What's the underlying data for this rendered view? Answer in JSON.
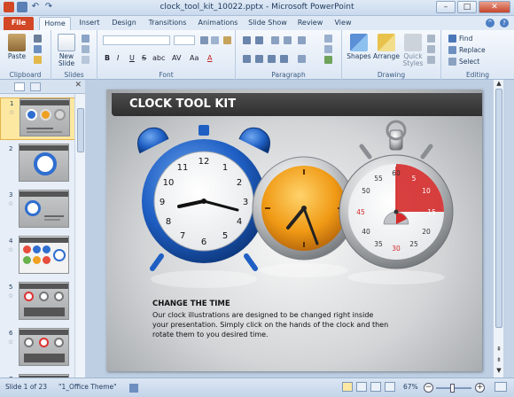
{
  "window": {
    "title": "clock_tool_kit_10022.pptx - Microsoft PowerPoint"
  },
  "tabs": [
    "File",
    "Home",
    "Insert",
    "Design",
    "Transitions",
    "Animations",
    "Slide Show",
    "Review",
    "View"
  ],
  "ribbon": {
    "clipboard": {
      "paste": "Paste",
      "label": "Clipboard"
    },
    "slides": {
      "new_slide_1": "New",
      "new_slide_2": "Slide",
      "label": "Slides"
    },
    "font": {
      "label": "Font",
      "bold": "B",
      "italic": "I",
      "underline": "U",
      "strike": "S",
      "shadow": "abc",
      "spacing": "AV",
      "case": "Aa",
      "color": "A"
    },
    "paragraph": {
      "label": "Paragraph"
    },
    "drawing": {
      "shapes": "Shapes",
      "arrange": "Arrange",
      "quick_styles_1": "Quick",
      "quick_styles_2": "Styles",
      "label": "Drawing"
    },
    "editing": {
      "find": "Find",
      "replace": "Replace",
      "select": "Select",
      "label": "Editing"
    }
  },
  "thumbnails": [
    {
      "num": "1",
      "selected": true
    },
    {
      "num": "2",
      "selected": false
    },
    {
      "num": "3",
      "selected": false
    },
    {
      "num": "4",
      "selected": false
    },
    {
      "num": "5",
      "selected": false
    },
    {
      "num": "6",
      "selected": false
    },
    {
      "num": "7",
      "selected": false
    }
  ],
  "slide": {
    "title": "CLOCK TOOL KIT",
    "heading": "CHANGE THE TIME",
    "body": "Our clock illustrations are designed to be changed right inside your presentation.  Simply click on the hands of the clock and then rotate them to you desired time.",
    "stopwatch_numbers": [
      "60",
      "5",
      "10",
      "15",
      "20",
      "25",
      "30",
      "35",
      "40",
      "45",
      "50",
      "55"
    ]
  },
  "status": {
    "slide_info": "Slide 1 of 23",
    "theme": "\"1_Office Theme\"",
    "zoom": "67%"
  },
  "colors": {
    "file_tab": "#d24726",
    "slide_title_bar": "#3a3a3a",
    "alarm_clock_blue": "#1f5fc4",
    "wall_clock_orange": "#f09a15",
    "stopwatch_red": "#d42a2a"
  }
}
